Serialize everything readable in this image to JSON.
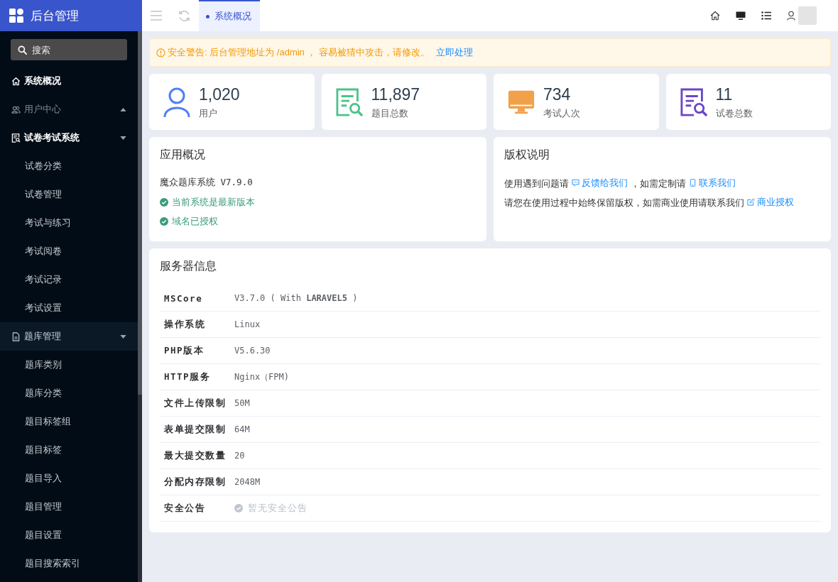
{
  "sidebar": {
    "title": "后台管理",
    "search": {
      "placeholder": "搜索"
    },
    "items": [
      {
        "kind": "link",
        "label": "系统概况",
        "selected": true
      },
      {
        "kind": "group",
        "label": "用户中心",
        "disabled": true,
        "expanded": false,
        "active": false,
        "highlighted": false
      },
      {
        "kind": "group",
        "label": "试卷考试系统",
        "disabled": false,
        "expanded": true,
        "active": true,
        "highlighted": false,
        "children": [
          {
            "label": "试卷分类",
            "selected": false
          },
          {
            "label": "试卷管理",
            "selected": false
          },
          {
            "label": "考试与练习",
            "selected": false
          },
          {
            "label": "考试阅卷",
            "selected": false
          },
          {
            "label": "考试记录",
            "selected": false
          },
          {
            "label": "考试设置",
            "selected": false
          }
        ]
      },
      {
        "kind": "group",
        "label": "题库管理",
        "disabled": false,
        "expanded": true,
        "active": false,
        "highlighted": true,
        "children": [
          {
            "label": "题库类别",
            "selected": false
          },
          {
            "label": "题库分类",
            "selected": false
          },
          {
            "label": "题目标签组",
            "selected": false
          },
          {
            "label": "题目标签",
            "selected": false
          },
          {
            "label": "题目导入",
            "selected": false
          },
          {
            "label": "题目管理",
            "selected": false
          },
          {
            "label": "题目设置",
            "selected": false
          },
          {
            "label": "题目搜索索引",
            "selected": false
          }
        ]
      }
    ]
  },
  "topbar": {
    "tabs": [
      {
        "label": "系统概况",
        "selected": true
      }
    ]
  },
  "alert": {
    "text": "安全警告: 后台管理地址为 /admin ， 容易被猜中攻击，请修改。",
    "link": "立即处理"
  },
  "stats": [
    {
      "value": "1,020",
      "label": "用户",
      "color": "#4f7ef7"
    },
    {
      "value": "11,897",
      "label": "题目总数",
      "color": "#4cc38a"
    },
    {
      "value": "734",
      "label": "考试人次",
      "color": "#f0a14a"
    },
    {
      "value": "11",
      "label": "试卷总数",
      "color": "#6b46c8"
    }
  ],
  "app_overview": {
    "title": "应用概况",
    "product": "魔众题库系统 V7.9.0",
    "statuses": [
      "当前系统是最新版本",
      "域名已授权"
    ]
  },
  "copyright": {
    "title": "版权说明",
    "lines": [
      [
        {
          "kind": "text",
          "text": "使用遇到问题请"
        },
        {
          "kind": "link",
          "text": "反馈给我们"
        },
        {
          "kind": "text",
          "text": "，如需定制请"
        },
        {
          "kind": "link",
          "text": "联系我们"
        }
      ],
      [
        {
          "kind": "text",
          "text": "请您在使用过程中始终保留版权，如需商业使用请联系我们"
        },
        {
          "kind": "link",
          "text": "商业授权"
        }
      ]
    ]
  },
  "server_info": {
    "title": "服务器信息",
    "rows": [
      {
        "kind": "value",
        "label": "MSCore",
        "value": "V3.7.0 ( With **LARAVEL5** )"
      },
      {
        "kind": "value",
        "label": "操作系统",
        "value": "Linux"
      },
      {
        "kind": "value",
        "label": "PHP版本",
        "value": "V5.6.30"
      },
      {
        "kind": "value",
        "label": "HTTP服务",
        "value": "Nginx（FPM)"
      },
      {
        "kind": "value",
        "label": "文件上传限制",
        "value": "50M"
      },
      {
        "kind": "value",
        "label": "表单提交限制",
        "value": "64M"
      },
      {
        "kind": "value",
        "label": "最大提交数量",
        "value": "20"
      },
      {
        "kind": "value",
        "label": "分配内存限制",
        "value": "2048M"
      },
      {
        "kind": "notice",
        "label": "安全公告",
        "value": "暂无安全公告"
      }
    ]
  }
}
